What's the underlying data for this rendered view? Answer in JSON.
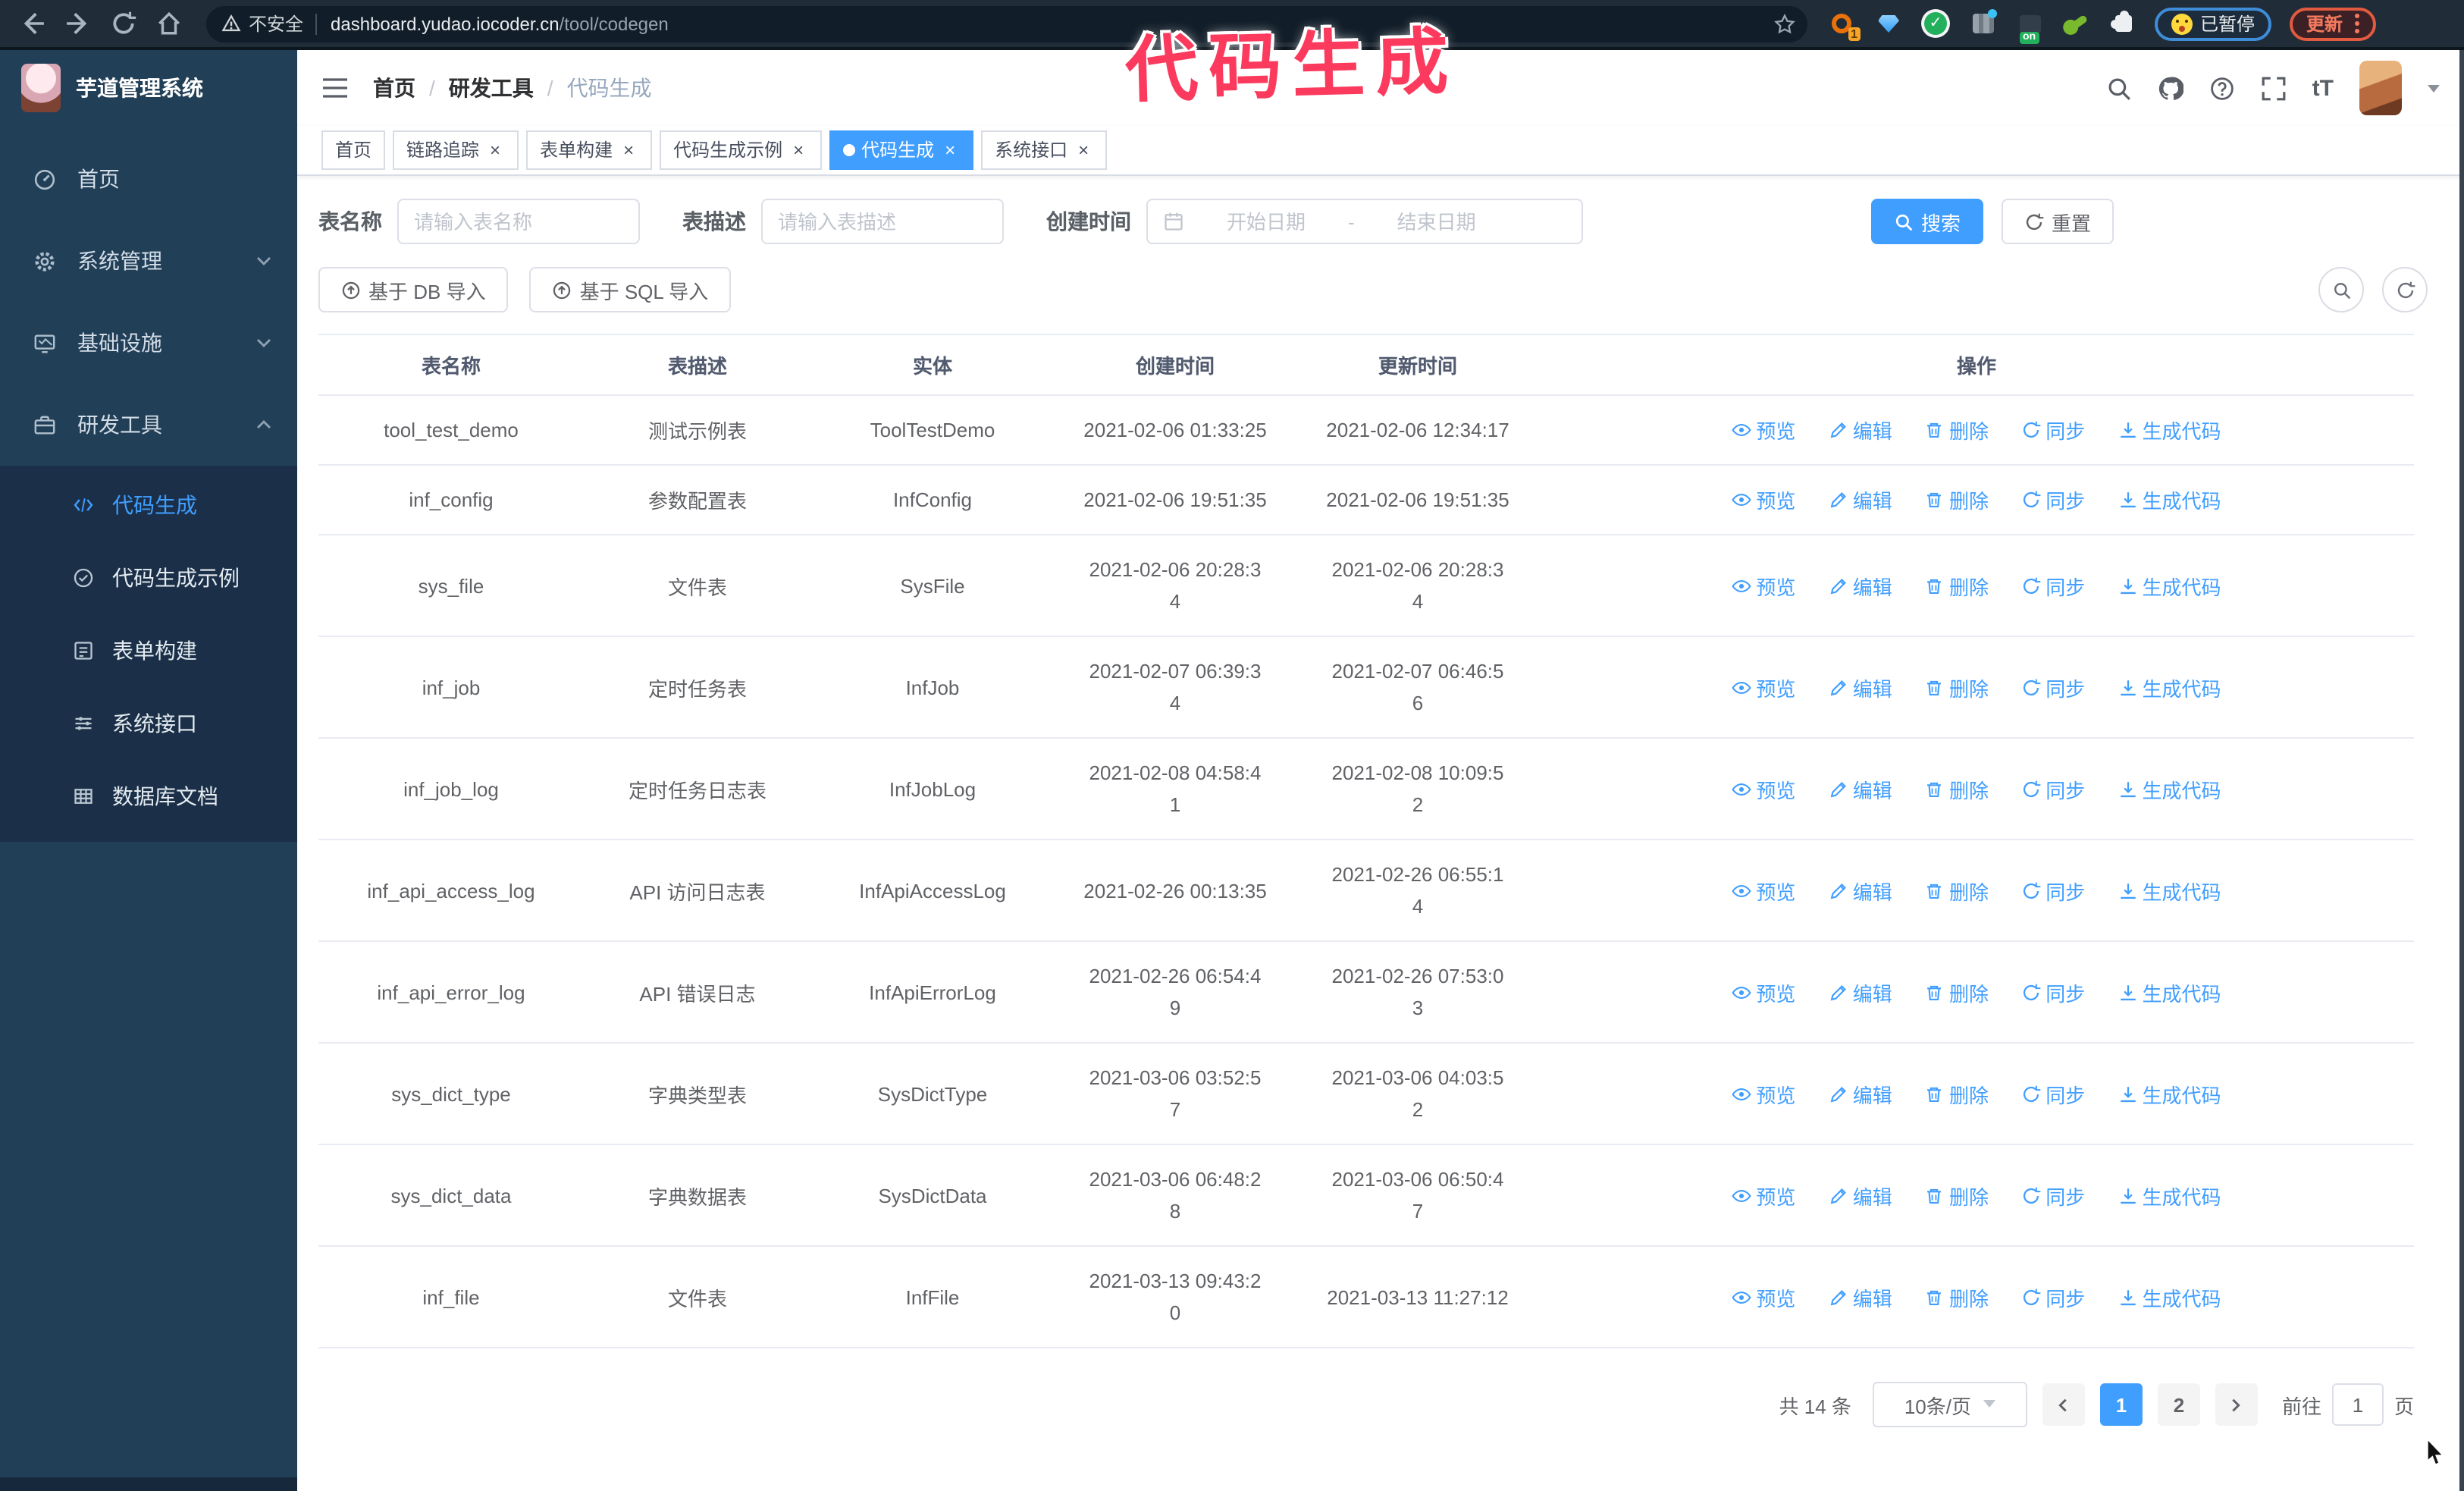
{
  "browser": {
    "security_label": "不安全",
    "url_host": "dashboard.yudao.iocoder.cn",
    "url_path": "/tool/codegen",
    "extension_badge": "1",
    "extension_on_badge": "on",
    "paused_label": "已暂停",
    "update_label": "更新"
  },
  "annotation": {
    "text": "代码生成",
    "color": "#fb3a5d"
  },
  "sidebar": {
    "title": "芋道管理系统",
    "items": [
      {
        "label": "首页"
      },
      {
        "label": "系统管理"
      },
      {
        "label": "基础设施"
      },
      {
        "label": "研发工具"
      }
    ],
    "submenu": [
      {
        "label": "代码生成",
        "active": true
      },
      {
        "label": "代码生成示例"
      },
      {
        "label": "表单构建"
      },
      {
        "label": "系统接口"
      },
      {
        "label": "数据库文档"
      }
    ]
  },
  "header": {
    "breadcrumb": [
      "首页",
      "研发工具",
      "代码生成"
    ],
    "separator": "/"
  },
  "tabs": [
    {
      "label": "首页"
    },
    {
      "label": "链路追踪"
    },
    {
      "label": "表单构建"
    },
    {
      "label": "代码生成示例"
    },
    {
      "label": "代码生成",
      "active": true
    },
    {
      "label": "系统接口"
    }
  ],
  "icons": {
    "close": "×"
  },
  "search_form": {
    "name_label": "表名称",
    "name_placeholder": "请输入表名称",
    "desc_label": "表描述",
    "desc_placeholder": "请输入表描述",
    "time_label": "创建时间",
    "start_placeholder": "开始日期",
    "range_separator": "-",
    "end_placeholder": "结束日期",
    "search_label": "搜索",
    "reset_label": "重置"
  },
  "toolbar": {
    "import_db": "基于 DB 导入",
    "import_sql": "基于 SQL 导入"
  },
  "table": {
    "columns": [
      "表名称",
      "表描述",
      "实体",
      "创建时间",
      "更新时间",
      "操作"
    ],
    "actions": [
      "预览",
      "编辑",
      "删除",
      "同步",
      "生成代码"
    ],
    "rows": [
      {
        "name": "tool_test_demo",
        "desc": "测试示例表",
        "entity": "ToolTestDemo",
        "created": "2021-02-06 01:33:25",
        "updated": "2021-02-06 12:34:17"
      },
      {
        "name": "inf_config",
        "desc": "参数配置表",
        "entity": "InfConfig",
        "created": "2021-02-06 19:51:35",
        "updated": "2021-02-06 19:51:35"
      },
      {
        "name": "sys_file",
        "desc": "文件表",
        "entity": "SysFile",
        "created": "2021-02-06 20:28:3\n4",
        "updated": "2021-02-06 20:28:3\n4"
      },
      {
        "name": "inf_job",
        "desc": "定时任务表",
        "entity": "InfJob",
        "created": "2021-02-07 06:39:3\n4",
        "updated": "2021-02-07 06:46:5\n6"
      },
      {
        "name": "inf_job_log",
        "desc": "定时任务日志表",
        "entity": "InfJobLog",
        "created": "2021-02-08 04:58:4\n1",
        "updated": "2021-02-08 10:09:5\n2"
      },
      {
        "name": "inf_api_access_log",
        "desc": "API 访问日志表",
        "entity": "InfApiAccessLog",
        "created": "2021-02-26 00:13:35",
        "updated": "2021-02-26 06:55:1\n4"
      },
      {
        "name": "inf_api_error_log",
        "desc": "API 错误日志",
        "entity": "InfApiErrorLog",
        "created": "2021-02-26 06:54:4\n9",
        "updated": "2021-02-26 07:53:0\n3"
      },
      {
        "name": "sys_dict_type",
        "desc": "字典类型表",
        "entity": "SysDictType",
        "created": "2021-03-06 03:52:5\n7",
        "updated": "2021-03-06 04:03:5\n2"
      },
      {
        "name": "sys_dict_data",
        "desc": "字典数据表",
        "entity": "SysDictData",
        "created": "2021-03-06 06:48:2\n8",
        "updated": "2021-03-06 06:50:4\n7"
      },
      {
        "name": "inf_file",
        "desc": "文件表",
        "entity": "InfFile",
        "created": "2021-03-13 09:43:2\n0",
        "updated": "2021-03-13 11:27:12"
      }
    ]
  },
  "pagination": {
    "total": "共 14 条",
    "page_size": "10条/页",
    "pages": [
      "1",
      "2"
    ],
    "goto_label": "前往",
    "goto_value": "1",
    "goto_unit": "页"
  },
  "colors": {
    "accent": "#409eff",
    "annotation": "#fb3a5d",
    "sidebar_bg": "#223f58",
    "submenu_bg": "#1b3048"
  }
}
